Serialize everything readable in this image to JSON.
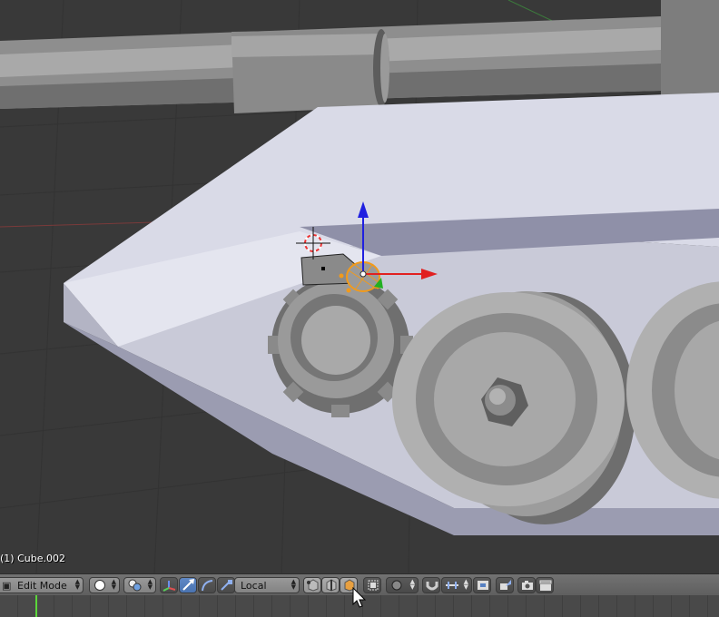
{
  "viewport": {
    "object_label": "(1) Cube.002"
  },
  "header": {
    "mode_label": "Edit Mode",
    "orientation_label": "Local",
    "icons": {
      "mode": "editmode-icon",
      "viewport_shading": "solid-sphere-icon",
      "pivot": "pivot-point-icon",
      "manipulator": "manipulator-axes-icon",
      "translate": "translate-arrow-icon",
      "rotate": "rotate-arc-icon",
      "scale": "scale-icon",
      "vertex_select": "vertex-select-icon",
      "edge_select": "edge-select-icon",
      "face_select": "face-select-icon",
      "occlude": "occlude-geometry-icon",
      "proportional": "proportional-edit-icon",
      "snap": "magnet-icon",
      "snap_element": "snap-increment-icon",
      "snap_target": "snap-target-icon",
      "grab_cursor": "cursor-grab-icon",
      "render": "camera-icon",
      "render_animation": "clapper-icon"
    }
  },
  "colors": {
    "active": "#5680c2",
    "axis_x": "#e12020",
    "axis_z": "#2020e0",
    "playhead": "#5bd63a"
  }
}
